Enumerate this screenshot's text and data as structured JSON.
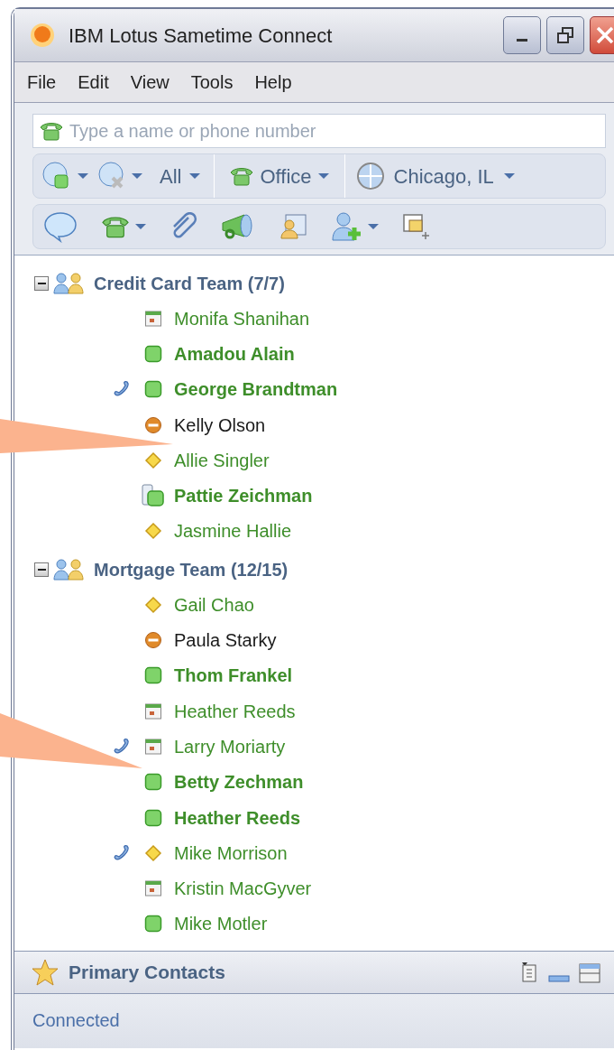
{
  "window": {
    "title": "IBM Lotus Sametime Connect"
  },
  "menu": [
    "File",
    "Edit",
    "View",
    "Tools",
    "Help"
  ],
  "search": {
    "placeholder": "Type a name or phone number"
  },
  "toolbar": {
    "filter": "All",
    "phone": "Office",
    "location": "Chicago, IL"
  },
  "groups": [
    {
      "name": "Credit Card Team (7/7)",
      "expanded": true,
      "children": [
        {
          "name": "Monifa Shanihan",
          "kind": "meeting",
          "bold": false,
          "on_phone": false
        },
        {
          "name": "Amadou Alain",
          "kind": "available",
          "bold": true,
          "on_phone": false
        },
        {
          "name": "George Brandtman",
          "kind": "available",
          "bold": true,
          "on_phone": true
        },
        {
          "name": "Kelly Olson",
          "kind": "dnd",
          "bold": false,
          "on_phone": false
        },
        {
          "name": "Allie Singler",
          "kind": "away",
          "bold": false,
          "on_phone": false
        },
        {
          "name": "Pattie Zeichman",
          "kind": "mobile",
          "bold": true,
          "on_phone": false
        },
        {
          "name": "Jasmine Hallie",
          "kind": "away",
          "bold": false,
          "on_phone": false
        }
      ]
    },
    {
      "name": "Mortgage Team (12/15)",
      "expanded": true,
      "children": [
        {
          "name": "Gail Chao",
          "kind": "away",
          "bold": false,
          "on_phone": false
        },
        {
          "name": "Paula Starky",
          "kind": "dnd",
          "bold": false,
          "on_phone": false
        },
        {
          "name": "Thom Frankel",
          "kind": "available",
          "bold": true,
          "on_phone": false
        },
        {
          "name": "Heather Reeds",
          "kind": "meeting",
          "bold": false,
          "on_phone": false
        },
        {
          "name": "Larry Moriarty",
          "kind": "meeting",
          "bold": false,
          "on_phone": true
        },
        {
          "name": "Betty Zechman",
          "kind": "available",
          "bold": true,
          "on_phone": false
        },
        {
          "name": "Heather Reeds",
          "kind": "available",
          "bold": true,
          "on_phone": false
        },
        {
          "name": "Mike Morrison",
          "kind": "away",
          "bold": false,
          "on_phone": true
        },
        {
          "name": "Kristin MacGyver",
          "kind": "meeting",
          "bold": false,
          "on_phone": false
        },
        {
          "name": "Mike Motler",
          "kind": "available",
          "bold": false,
          "on_phone": false
        }
      ]
    }
  ],
  "panel": {
    "title": "Primary Contacts"
  },
  "status_bar": "Connected"
}
